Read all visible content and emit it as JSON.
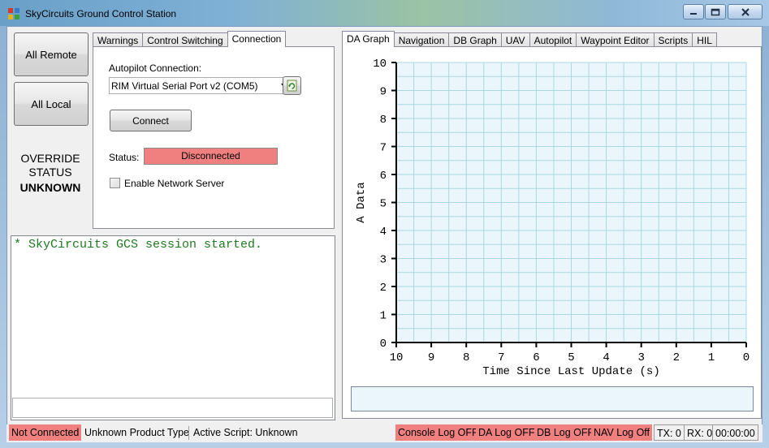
{
  "window": {
    "title": "SkyCircuits Ground Control Station"
  },
  "left_buttons": {
    "all_remote": "All Remote",
    "all_local": "All Local"
  },
  "override": {
    "line1": "OVERRIDE",
    "line2": "STATUS",
    "value": "UNKNOWN"
  },
  "left_tabs": [
    {
      "label": "Warnings",
      "active": false
    },
    {
      "label": "Control Switching",
      "active": false
    },
    {
      "label": "Connection",
      "active": true
    }
  ],
  "connection": {
    "autopilot_label": "Autopilot Connection:",
    "port_value": "RIM Virtual Serial Port v2 (COM5)",
    "connect_button": "Connect",
    "status_label": "Status:",
    "status_value": "Disconnected",
    "status_color": "#f08080",
    "network_server_label": "Enable Network Server",
    "network_server_checked": false
  },
  "console": {
    "log_text": "* SkyCircuits GCS session started.",
    "log_color": "#1f7a1f",
    "input_value": ""
  },
  "right_tabs": [
    {
      "label": "DA Graph",
      "active": true
    },
    {
      "label": "Navigation",
      "active": false
    },
    {
      "label": "DB Graph",
      "active": false
    },
    {
      "label": "UAV",
      "active": false
    },
    {
      "label": "Autopilot",
      "active": false
    },
    {
      "label": "Waypoint Editor",
      "active": false
    },
    {
      "label": "Scripts",
      "active": false
    },
    {
      "label": "HIL",
      "active": false
    }
  ],
  "chart_data": {
    "type": "line",
    "xlabel": "Time Since Last Update (s)",
    "ylabel": "A Data",
    "xlim": [
      10,
      0
    ],
    "ylim": [
      0,
      10
    ],
    "x_ticks": [
      "10",
      "9",
      "8",
      "7",
      "6",
      "5",
      "4",
      "3",
      "2",
      "1",
      "0"
    ],
    "y_ticks": [
      "0",
      "1",
      "2",
      "3",
      "4",
      "5",
      "6",
      "7",
      "8",
      "9",
      "10"
    ],
    "grid": true,
    "plot_bg": "#eaf6fc",
    "grid_color": "#a8d8e4",
    "series": []
  },
  "graph_input": {
    "value": ""
  },
  "statusbar": {
    "connection": "Not Connected",
    "product": "Unknown Product Type",
    "script": "Active Script: Unknown",
    "console_log": "Console Log OFF",
    "da_log": "DA Log OFF",
    "db_log": "DB Log OFF",
    "nav_log": "NAV Log Off",
    "tx": "TX: 0",
    "rx": "RX: 0",
    "timer": "00:00:00",
    "off_color": "#f08080"
  },
  "icons": {
    "app": "app-icon",
    "minimize": "minimize-icon",
    "maximize": "maximize-icon",
    "close": "close-icon",
    "refresh": "refresh-icon",
    "dropdown": "chevron-down-icon"
  }
}
